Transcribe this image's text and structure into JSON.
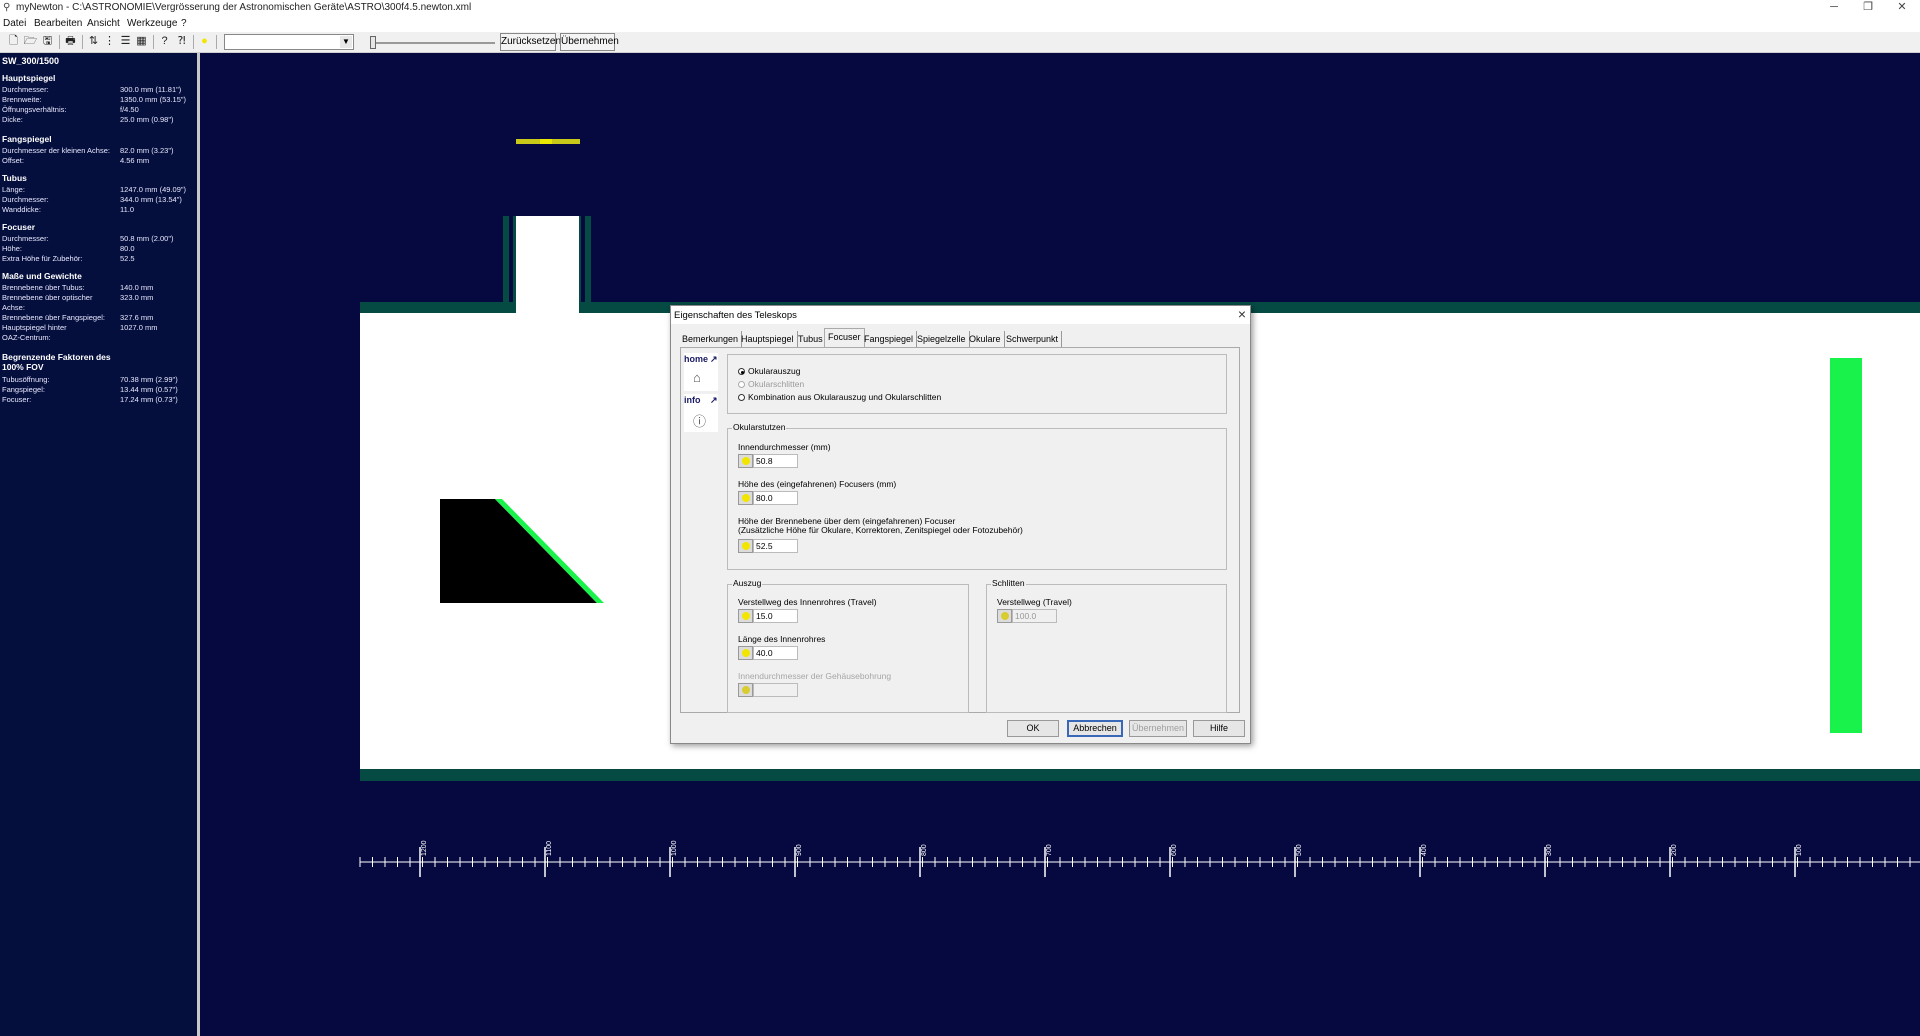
{
  "window": {
    "title": "myNewton - C:\\ASTRONOMIE\\Vergrösserung der Astronomischen Geräte\\ASTRO\\300f4.5.newton.xml",
    "minimize": "─",
    "maximize": "❐",
    "close": "✕"
  },
  "menu": [
    "Datei",
    "Bearbeiten",
    "Ansicht",
    "Werkzeuge",
    "?"
  ],
  "toolbar": {
    "combo_value": "",
    "reset_label": "Zurücksetzen",
    "apply_label": "Übernehmen"
  },
  "info_panel": {
    "model": "SW_300/1500",
    "sections": [
      {
        "title": "Hauptspiegel",
        "rows": [
          [
            "Durchmesser:",
            "300.0 mm (11.81\")"
          ],
          [
            "Brennweite:",
            "1350.0 mm (53.15\")"
          ],
          [
            "Öffnungsverhältnis:",
            "f/4.50"
          ],
          [
            "Dicke:",
            "25.0 mm (0.98\")"
          ]
        ]
      },
      {
        "title": "Fangspiegel",
        "rows": [
          [
            "Durchmesser der kleinen Achse:",
            "82.0 mm (3.23\")"
          ],
          [
            "Offset:",
            "4.56 mm"
          ]
        ]
      },
      {
        "title": "Tubus",
        "rows": [
          [
            "Länge:",
            "1247.0 mm (49.09\")"
          ],
          [
            "Durchmesser:",
            "344.0 mm (13.54\")"
          ],
          [
            "Wanddicke:",
            "11.0"
          ]
        ]
      },
      {
        "title": "Focuser",
        "rows": [
          [
            "Durchmesser:",
            "50.8 mm (2.00\")"
          ],
          [
            "Höhe:",
            "80.0"
          ],
          [
            "Extra Höhe für Zubehör:",
            "52.5"
          ]
        ]
      },
      {
        "title": "Maße und Gewichte",
        "rows": [
          [
            "Brennebene über Tubus:",
            "140.0 mm"
          ],
          [
            "Brennebene über optischer",
            "323.0 mm"
          ],
          [
            "Achse:",
            ""
          ],
          [
            "Brennebene über Fangspiegel:",
            "327.6 mm"
          ],
          [
            "Hauptspiegel hinter",
            "1027.0 mm"
          ],
          [
            "OAZ-Centrum:",
            ""
          ]
        ]
      },
      {
        "title": "Begrenzende Faktoren des 100% FOV",
        "rows": [
          [
            "Tubusöffnung:",
            "70.38 mm (2.99\")"
          ],
          [
            "Fangspiegel:",
            "13.44 mm (0.57\")"
          ],
          [
            "Focuser:",
            "17.24 mm (0.73\")"
          ]
        ]
      }
    ]
  },
  "ruler_labels": [
    "1200",
    "1100",
    "1000",
    "900",
    "800",
    "700",
    "600",
    "500",
    "400",
    "300",
    "200",
    "100"
  ],
  "colors": {
    "canvas_bg": "#060840",
    "tube": "#ffffff",
    "tube_edge": "#064a44",
    "mirror": "#19f24a",
    "focuser_marker": "#c9c91a"
  },
  "dialog": {
    "title": "Eigenschaften des Teleskops",
    "tabs": [
      "Bemerkungen",
      "Hauptspiegel",
      "Tubus",
      "Focuser",
      "Fangspiegel",
      "Spiegelzelle",
      "Okulare",
      "Schwerpunkt"
    ],
    "active_tab": "Focuser",
    "side_home": "home",
    "side_info": "info",
    "mode": {
      "options": [
        "Okularauszug",
        "Okularschlitten",
        "Kombination aus Okularauszug und Okularschlitten"
      ],
      "selected": "Okularauszug"
    },
    "okularstutzen": {
      "title": "Okularstutzen",
      "inner_label": "Innendurchmesser (mm)",
      "inner_value": "50.8",
      "height_label": "Höhe des (eingefahrenen) Focusers (mm)",
      "height_value": "80.0",
      "focal_label1": "Höhe der Brennebene über dem (eingefahrenen) Focuser",
      "focal_label2": "(Zusätzliche Höhe für Okulare, Korrektoren, Zenitspiegel oder Fotozubehör)",
      "focal_value": "52.5"
    },
    "auszug": {
      "title": "Auszug",
      "travel_label": "Verstellweg des Innenrohres (Travel)",
      "travel_value": "15.0",
      "length_label": "Länge des Innenrohres",
      "length_value": "40.0",
      "housing_label": "Innendurchmesser der Gehäusebohrung",
      "housing_value": ""
    },
    "schlitten": {
      "title": "Schlitten",
      "travel_label": "Verstellweg (Travel)",
      "travel_value": "100.0"
    },
    "buttons": {
      "ok": "OK",
      "cancel": "Abbrechen",
      "apply": "Übernehmen",
      "help": "Hilfe"
    }
  }
}
